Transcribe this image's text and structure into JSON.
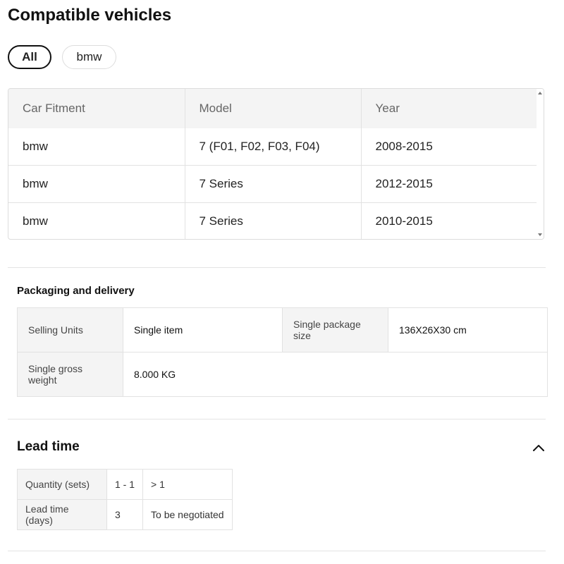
{
  "compatible": {
    "title": "Compatible vehicles",
    "chips": [
      {
        "label": "All",
        "active": true
      },
      {
        "label": "bmw",
        "active": false
      }
    ],
    "columns": [
      "Car Fitment",
      "Model",
      "Year"
    ],
    "rows": [
      [
        "bmw",
        "7 (F01, F02, F03, F04)",
        "2008-2015"
      ],
      [
        "bmw",
        "7 Series",
        "2012-2015"
      ],
      [
        "bmw",
        "7 Series",
        "2010-2015"
      ]
    ]
  },
  "packaging": {
    "title": "Packaging and delivery",
    "selling_units_label": "Single item",
    "selling_units_key": "Selling Units",
    "package_size_key": "Single package size",
    "package_size_value": "136X26X30 cm",
    "gross_weight_key": "Single gross weight",
    "gross_weight_value": "8.000 KG"
  },
  "lead_time": {
    "title": "Lead time",
    "quantity_label": "Quantity (sets)",
    "quantity_values": [
      "1 - 1",
      "> 1"
    ],
    "days_label": "Lead time (days)",
    "days_values": [
      "3",
      "To be negotiated"
    ]
  },
  "icons": {
    "collapse": "chevron-up-icon",
    "scroll_up": "scroll-up-arrow-icon",
    "scroll_down": "scroll-down-arrow-icon"
  }
}
